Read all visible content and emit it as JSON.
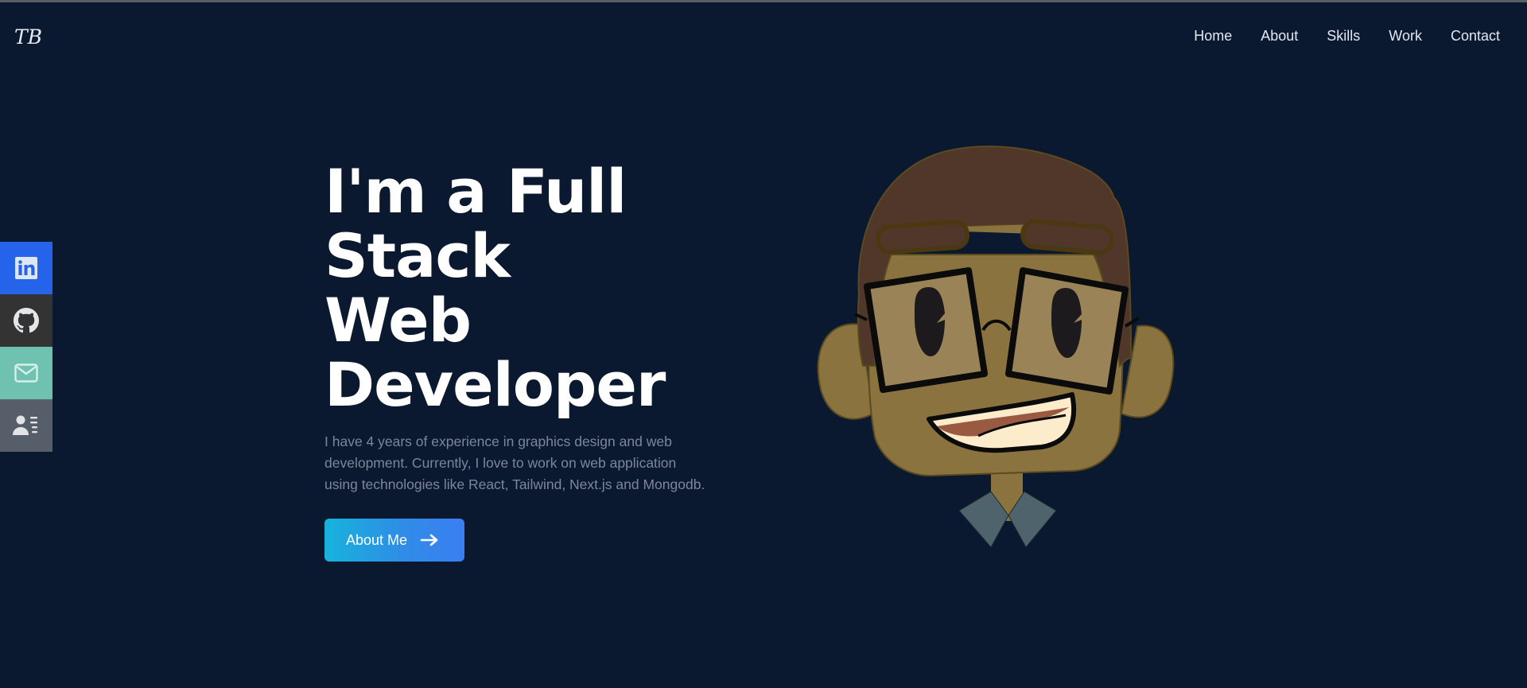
{
  "navbar": {
    "logo": "TB",
    "links": [
      {
        "label": "Home"
      },
      {
        "label": "About"
      },
      {
        "label": "Skills"
      },
      {
        "label": "Work"
      },
      {
        "label": "Contact"
      }
    ]
  },
  "social": [
    {
      "name": "LinkedIn",
      "icon": "linkedin-icon",
      "color": "#2563eb"
    },
    {
      "name": "GitHub",
      "icon": "github-icon",
      "color": "#333333"
    },
    {
      "name": "Email",
      "icon": "mail-icon",
      "color": "#6fc2b0"
    },
    {
      "name": "Resume",
      "icon": "resume-icon",
      "color": "#565f69"
    }
  ],
  "hero": {
    "title_line1": "I'm a Full Stack",
    "title_line2": "Web",
    "title_line3": "Developer",
    "description": "I have 4 years of experience in graphics design and web development. Currently, I love to work on web application using technologies like React, Tailwind, Next.js and Mongodb.",
    "cta_label": "About Me",
    "cta_icon": "arrow-right-icon"
  },
  "avatar": {
    "alt": "cartoon avatar with glasses",
    "colors": {
      "skin": "#8a733f",
      "hair": "#50372a",
      "collar": "#4f636d",
      "background": "#0a192f"
    }
  }
}
